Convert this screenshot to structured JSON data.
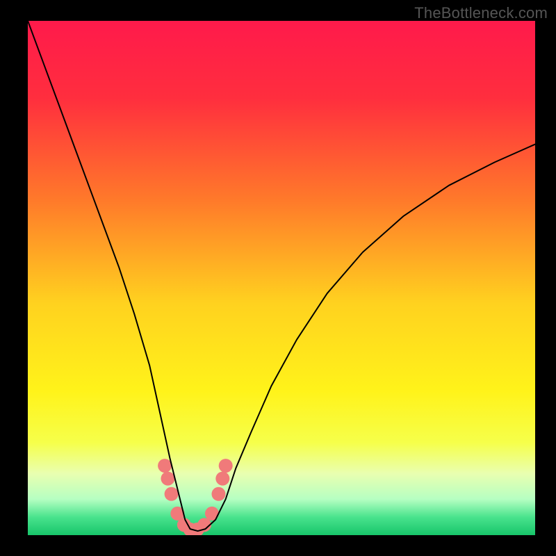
{
  "watermark": "TheBottleneck.com",
  "chart_data": {
    "type": "line",
    "title": "",
    "xlabel": "",
    "ylabel": "",
    "xlim": [
      0,
      100
    ],
    "ylim": [
      0,
      100
    ],
    "background_gradient": {
      "stops": [
        {
          "offset": 0.0,
          "color": "#ff1a4b"
        },
        {
          "offset": 0.15,
          "color": "#ff2e3e"
        },
        {
          "offset": 0.35,
          "color": "#ff7a2a"
        },
        {
          "offset": 0.55,
          "color": "#ffd21f"
        },
        {
          "offset": 0.72,
          "color": "#fff31a"
        },
        {
          "offset": 0.82,
          "color": "#f6ff4a"
        },
        {
          "offset": 0.88,
          "color": "#e9ffb0"
        },
        {
          "offset": 0.93,
          "color": "#b6ffc2"
        },
        {
          "offset": 0.965,
          "color": "#49e38d"
        },
        {
          "offset": 1.0,
          "color": "#17c56a"
        }
      ]
    },
    "series": [
      {
        "name": "bottleneck-curve",
        "x": [
          0,
          3,
          6,
          9,
          12,
          15,
          18,
          21,
          24,
          26,
          28,
          30,
          31,
          32,
          33.5,
          35,
          37,
          39,
          41,
          44,
          48,
          53,
          59,
          66,
          74,
          83,
          92,
          100
        ],
        "y": [
          100,
          92,
          84,
          76,
          68,
          60,
          52,
          43,
          33,
          24,
          15,
          7,
          3,
          1.2,
          0.8,
          1.2,
          3,
          7,
          13,
          20,
          29,
          38,
          47,
          55,
          62,
          68,
          72.5,
          76
        ],
        "color": "#000000",
        "stroke_width": 2
      },
      {
        "name": "marker-band",
        "type": "scatter",
        "x": [
          27.0,
          27.6,
          28.3,
          29.5,
          30.8,
          32.0,
          33.4,
          34.8,
          36.3,
          37.6,
          38.4,
          39.0
        ],
        "y": [
          13.5,
          11.0,
          8.0,
          4.2,
          2.0,
          1.1,
          1.1,
          2.0,
          4.2,
          8.0,
          11.0,
          13.5
        ],
        "color": "#f07a7a",
        "marker_radius": 10
      }
    ]
  }
}
